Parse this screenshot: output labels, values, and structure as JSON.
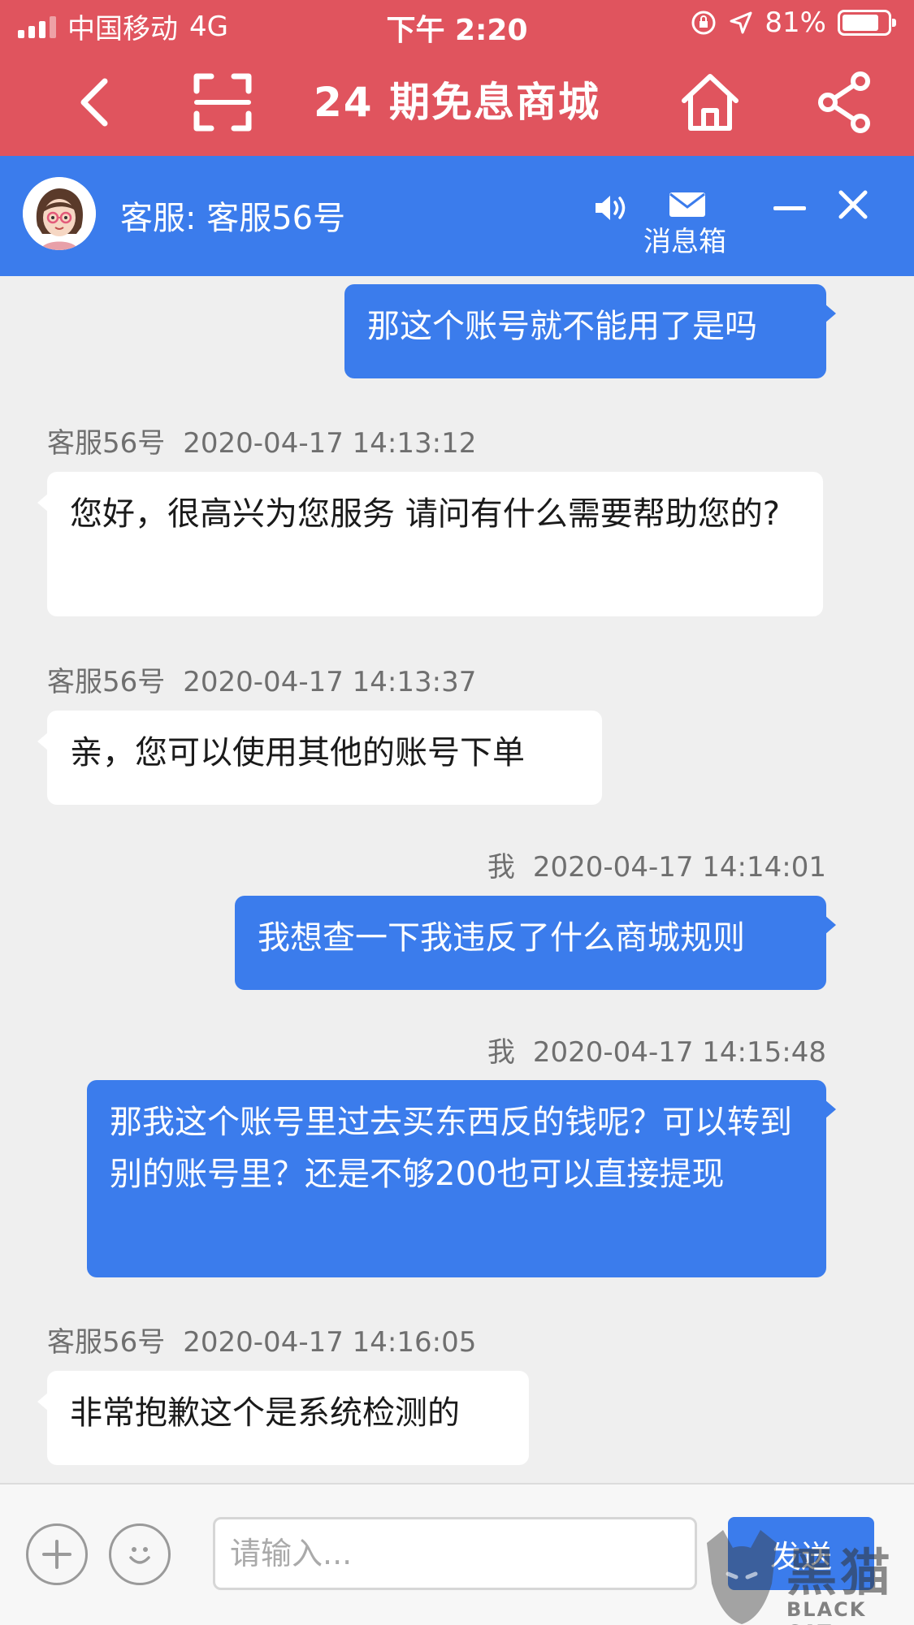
{
  "status_bar": {
    "carrier": "中国移动",
    "network": "4G",
    "time": "下午 2:20",
    "battery_percent": "81%",
    "battery_level": 0.81
  },
  "app_header": {
    "title": "24 期免息商城",
    "icons": [
      "back-arrow-icon",
      "scan-icon",
      "home-icon",
      "share-icon"
    ]
  },
  "chat_header": {
    "agent_name": "客服: 客服56号",
    "inbox_label": "消息箱",
    "icons": [
      "speaker-icon",
      "mail-icon",
      "minimize-icon",
      "close-icon"
    ]
  },
  "messages": [
    {
      "from": "me",
      "sender": "",
      "time": "",
      "text": "那这个账号就不能用了是吗"
    },
    {
      "from": "agent",
      "sender": "客服56号",
      "time": "2020-04-17 14:13:12",
      "text": "您好，很高兴为您服务 请问有什么需要帮助您的?"
    },
    {
      "from": "agent",
      "sender": "客服56号",
      "time": "2020-04-17 14:13:37",
      "text": "亲，您可以使用其他的账号下单"
    },
    {
      "from": "me",
      "sender": "我",
      "time": "2020-04-17 14:14:01",
      "text": "我想查一下我违反了什么商城规则"
    },
    {
      "from": "me",
      "sender": "我",
      "time": "2020-04-17 14:15:48",
      "text": "那我这个账号里过去买东西反的钱呢？可以转到别的账号里？还是不够200也可以直接提现"
    },
    {
      "from": "agent",
      "sender": "客服56号",
      "time": "2020-04-17 14:16:05",
      "text": "非常抱歉这个是系统检测的"
    }
  ],
  "input_bar": {
    "placeholder": "请输入...",
    "value": "",
    "send_label": "发送",
    "icons": [
      "add-icon",
      "emoji-icon"
    ]
  },
  "watermark": {
    "text_cn": "黑猫",
    "text_en": "BLACK CAT"
  },
  "colors": {
    "header_red": "#e0545e",
    "chat_blue": "#3b7cec",
    "background": "#efefef"
  }
}
